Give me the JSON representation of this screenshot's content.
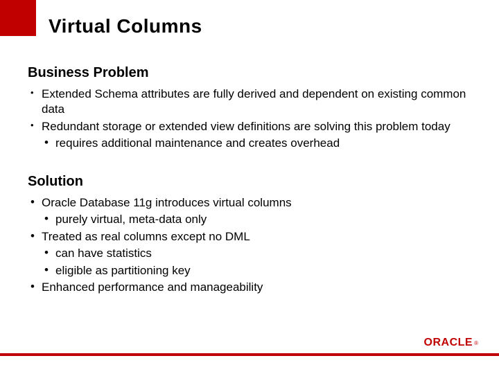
{
  "title": "Virtual Columns",
  "sections": {
    "problem": {
      "heading": "Business Problem",
      "items": {
        "i0": "Extended Schema attributes are fully derived and dependent on existing common data",
        "i1": "Redundant storage or extended view definitions are solving this problem today",
        "i1_sub0": "requires additional maintenance and creates overhead"
      }
    },
    "solution": {
      "heading": "Solution",
      "items": {
        "i0": "Oracle Database 11g introduces virtual columns",
        "i0_sub0": "purely virtual, meta-data only",
        "i1": "Treated as real columns except no DML",
        "i1_sub0": "can have statistics",
        "i1_sub1": "eligible as partitioning key",
        "i2": "Enhanced performance and manageability"
      }
    }
  },
  "brand": {
    "name": "ORACLE",
    "accent": "#c00000"
  }
}
